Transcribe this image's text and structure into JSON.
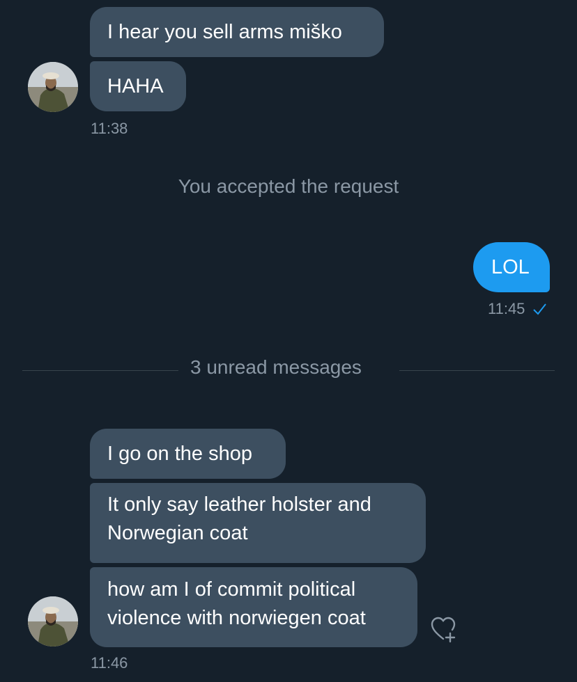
{
  "conversation": {
    "incoming_group_1": {
      "messages": [
        "I hear you sell arms miško",
        "HAHA"
      ],
      "time": "11:38",
      "avatar_icon": "user-avatar"
    },
    "system_notice": "You accepted the request",
    "outgoing": {
      "message": "LOL",
      "time": "11:45",
      "status_icon": "checkmark-icon"
    },
    "unread_divider": "3 unread messages",
    "incoming_group_2": {
      "messages": [
        "I go on the shop",
        [
          "It only say leather holster and",
          "Norwegian coat"
        ],
        [
          "how am I of commit political",
          "violence with norwiegen coat"
        ]
      ],
      "time": "11:46",
      "avatar_icon": "user-avatar",
      "reaction_icon": "heart-plus-icon"
    }
  },
  "colors": {
    "background": "#15202b",
    "incoming_bubble": "#3d4f60",
    "outgoing_bubble": "#1d9bf0",
    "meta_text": "#8b98a5"
  }
}
